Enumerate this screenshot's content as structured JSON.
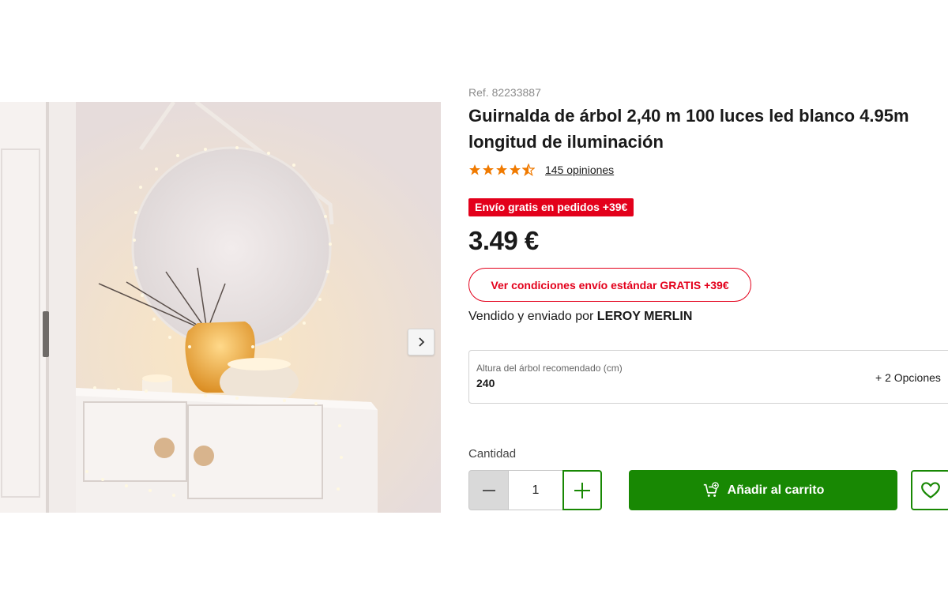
{
  "product": {
    "ref": "Ref. 82233887",
    "title": "Guirnalda de árbol 2,40 m 100 luces led blanco 4.95m longitud de iluminación",
    "rating": 4.5,
    "reviews_label": "145 opiniones",
    "promo_badge": "Envío gratis en pedidos +39€",
    "price": "3.49 €",
    "shipping_button": "Ver condiciones envío estándar GRATIS +39€",
    "seller_prefix": "Vendido y enviado por ",
    "seller_name": "LEROY MERLIN"
  },
  "option": {
    "label": "Altura del árbol recomendado (cm)",
    "value": "240",
    "more": "+ 2 Opciones"
  },
  "quantity": {
    "label": "Cantidad",
    "value": "1"
  },
  "actions": {
    "add_to_cart": "Añadir al carrito"
  },
  "icons": {
    "gallery_next": "chevron-right-icon",
    "minus": "minus-icon",
    "plus": "plus-icon",
    "cart": "cart-add-icon",
    "wishlist": "heart-icon",
    "star": "star-icon"
  },
  "colors": {
    "brand_green": "#188803",
    "promo_red": "#e3001b",
    "star_orange": "#f07a00",
    "text": "#1a1a1a"
  }
}
